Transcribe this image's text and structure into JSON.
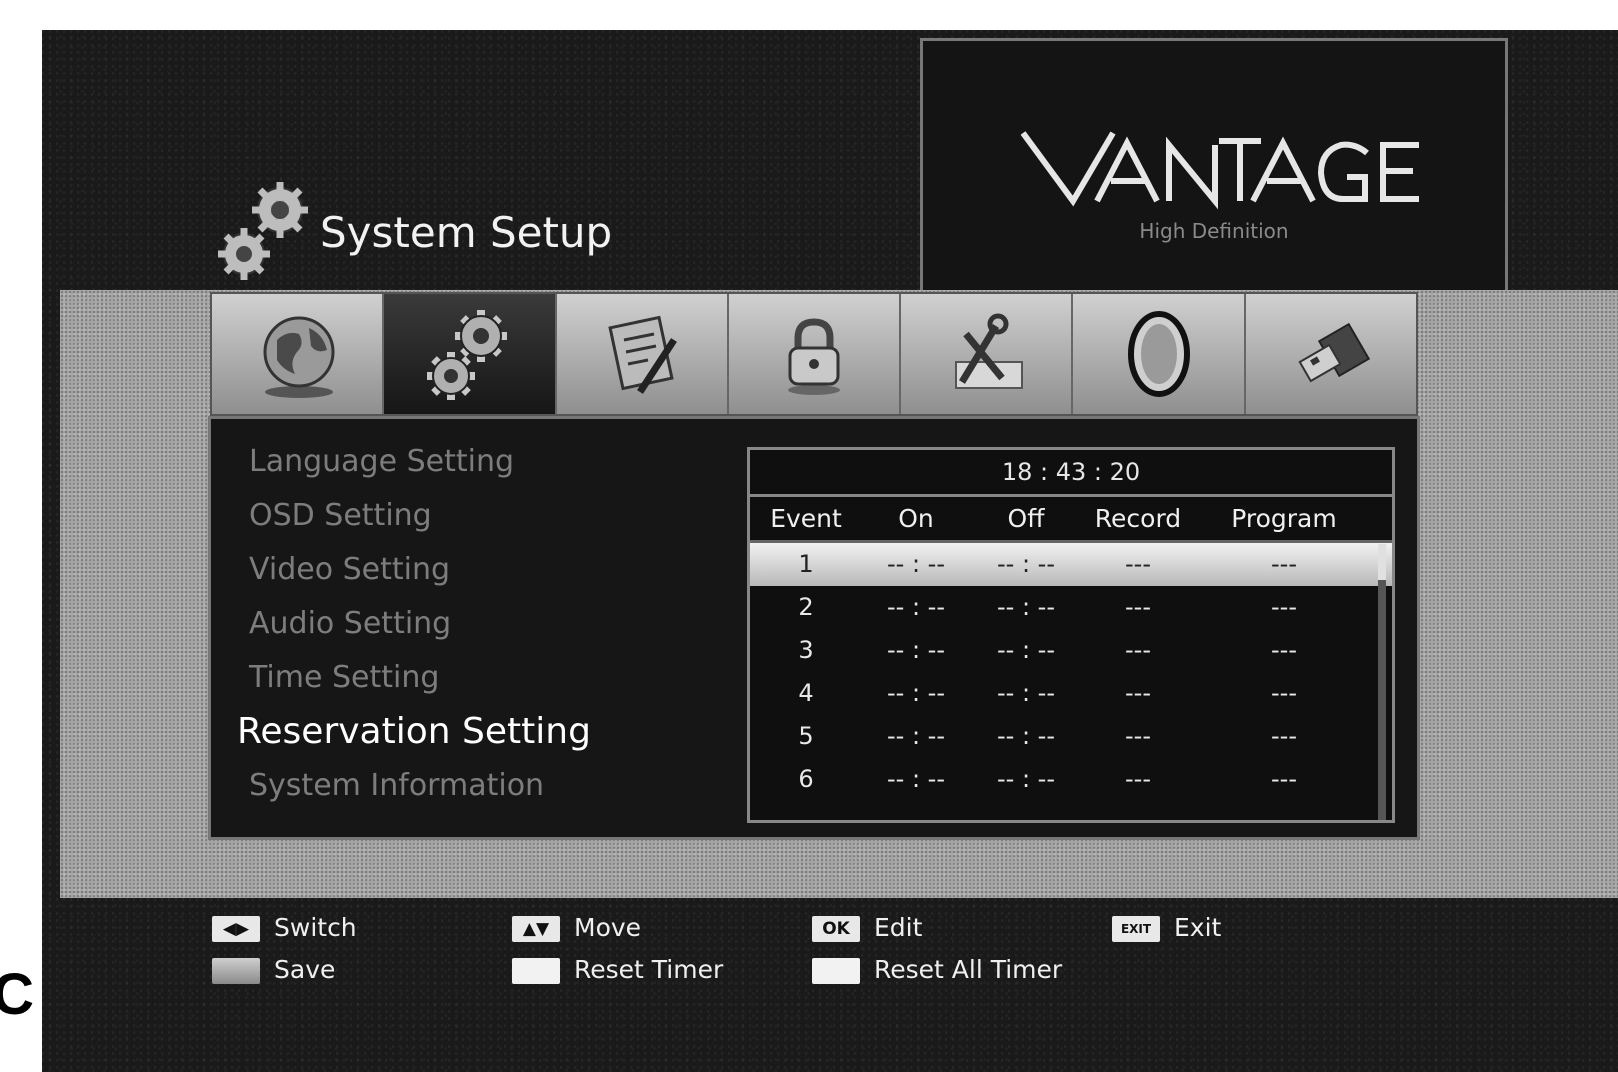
{
  "figure_label": "C",
  "header": {
    "title": "System Setup"
  },
  "logo": {
    "name": "VANTAGE",
    "subtitle": "High Definition"
  },
  "tabs": [
    {
      "icon": "globe-icon",
      "active": false
    },
    {
      "icon": "gears-icon",
      "active": true
    },
    {
      "icon": "edit-document-icon",
      "active": false
    },
    {
      "icon": "padlock-icon",
      "active": false
    },
    {
      "icon": "tools-icon",
      "active": false
    },
    {
      "icon": "circle-ring-icon",
      "active": false
    },
    {
      "icon": "usb-icon",
      "active": false
    }
  ],
  "menu": {
    "items": [
      {
        "label": "Language Setting"
      },
      {
        "label": "OSD Setting"
      },
      {
        "label": "Video Setting"
      },
      {
        "label": "Audio Setting"
      },
      {
        "label": "Time Setting"
      },
      {
        "label": "Reservation Setting",
        "selected": true
      },
      {
        "label": "System Information"
      }
    ]
  },
  "timer": {
    "clock": "18 : 43 : 20",
    "headers": {
      "event": "Event",
      "on": "On",
      "off": "Off",
      "record": "Record",
      "program": "Program"
    },
    "rows": [
      {
        "event": "1",
        "on": "-- : --",
        "off": "-- : --",
        "record": "---",
        "program": "---"
      },
      {
        "event": "2",
        "on": "-- : --",
        "off": "-- : --",
        "record": "---",
        "program": "---"
      },
      {
        "event": "3",
        "on": "-- : --",
        "off": "-- : --",
        "record": "---",
        "program": "---"
      },
      {
        "event": "4",
        "on": "-- : --",
        "off": "-- : --",
        "record": "---",
        "program": "---"
      },
      {
        "event": "5",
        "on": "-- : --",
        "off": "-- : --",
        "record": "---",
        "program": "---"
      },
      {
        "event": "6",
        "on": "-- : --",
        "off": "-- : --",
        "record": "---",
        "program": "---"
      }
    ]
  },
  "legend": {
    "switch_key": "◀▶",
    "switch": "Switch",
    "move_key": "▲▼",
    "move": "Move",
    "edit_key": "OK",
    "edit": "Edit",
    "exit_key": "EXIT",
    "exit": "Exit",
    "save": "Save",
    "reset_timer": "Reset Timer",
    "reset_all_timer": "Reset All Timer"
  }
}
